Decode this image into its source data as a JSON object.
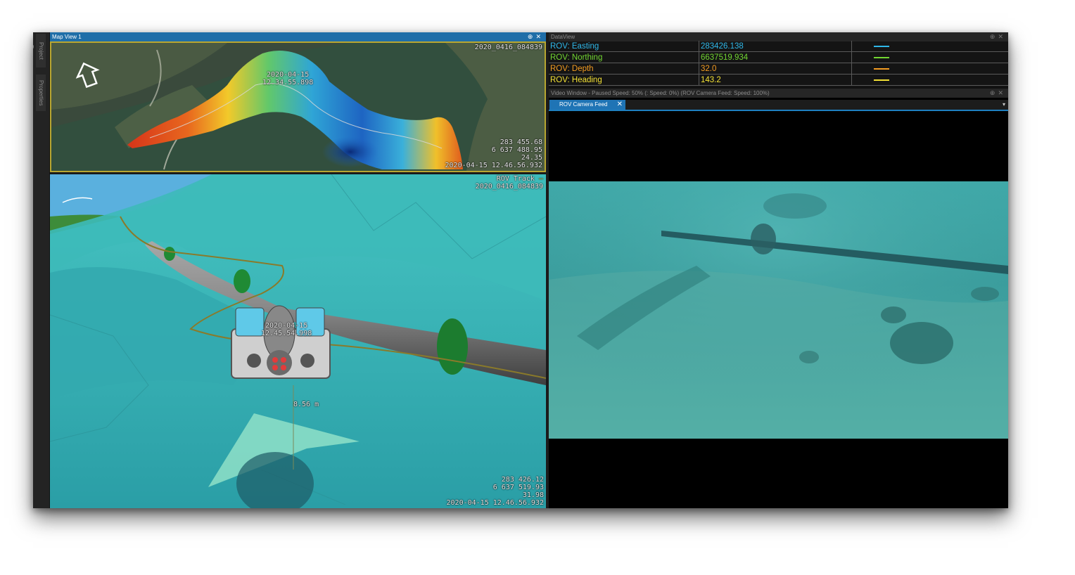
{
  "map_panel": {
    "title": "Map View 1",
    "session_id": "2020_0416_084839",
    "track_label": "2020-04-15\n12.34.55.898",
    "coords": [
      "283 455.68",
      "6 637 488.95",
      "24.35",
      "2020-04-15 12.46.56.932"
    ]
  },
  "side_tabs": [
    "Project Tree",
    "Properties"
  ],
  "scene_panel": {
    "track_legend": "ROV Track",
    "session_id": "2020_0416_084839",
    "rov_label": "2020-04-15\n12.45.54.998",
    "distance": "8.56 m",
    "coords": [
      "283 426.12",
      "6 637 519.93",
      "31.98",
      "2020-04-15 12.46.56.932"
    ]
  },
  "data_view": {
    "title": "DataView",
    "rows": [
      {
        "name": "ROV: Easting",
        "value": "283426.138",
        "color": "#2fb7e8"
      },
      {
        "name": "ROV: Northing",
        "value": "6637519.934",
        "color": "#72d632"
      },
      {
        "name": "ROV: Depth",
        "value": "32.0",
        "color": "#f39c22"
      },
      {
        "name": "ROV: Heading",
        "value": "143.2",
        "color": "#f2e035"
      }
    ]
  },
  "video_panel": {
    "title": "Video Window - Paused Speed: 50% (: Speed: 0%) (ROV Camera Feed: Speed: 100%)",
    "tab_label": "ROV Camera Feed",
    "tab_close": "✕",
    "menu_icon": "▾"
  },
  "icons": {
    "pin": "⊕",
    "close": "✕",
    "compass": "north-arrow-icon"
  },
  "colors": {
    "accent": "#1f74b5",
    "map_border": "#b8a631",
    "seafloor": "#3bb5b3"
  }
}
